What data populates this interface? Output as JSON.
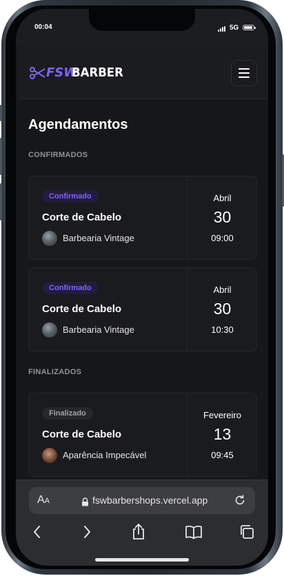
{
  "status_bar": {
    "time": "00:04",
    "network": "5G"
  },
  "header": {
    "logo_accent": "FSW",
    "logo_text": "BARBER",
    "logo_icon": "scissors-icon",
    "menu_icon": "menu-icon"
  },
  "page": {
    "title": "Agendamentos"
  },
  "sections": {
    "confirmed": {
      "label": "CONFIRMADOS",
      "bookings": [
        {
          "status": "Confirmado",
          "service": "Corte de Cabelo",
          "shop": "Barbearia Vintage",
          "month": "Abril",
          "day": "30",
          "time": "09:00"
        },
        {
          "status": "Confirmado",
          "service": "Corte de Cabelo",
          "shop": "Barbearia Vintage",
          "month": "Abril",
          "day": "30",
          "time": "10:30"
        }
      ]
    },
    "finished": {
      "label": "FINALIZADOS",
      "bookings": [
        {
          "status": "Finalizado",
          "service": "Corte de Cabelo",
          "shop": "Aparência Impecável",
          "month": "Fevereiro",
          "day": "13",
          "time": "09:45"
        }
      ]
    }
  },
  "browser": {
    "text_size_label_large": "A",
    "text_size_label_small": "A",
    "url": "fswbarbershops.vercel.app",
    "toolbar_icons": [
      "back-icon",
      "forward-icon",
      "share-icon",
      "bookmarks-icon",
      "tabs-icon"
    ]
  },
  "colors": {
    "accent": "#8162ff",
    "background": "#161719",
    "card": "#1a1b1f",
    "badge_confirmed_bg": "#221c3d",
    "badge_finished_bg": "#26272b"
  }
}
